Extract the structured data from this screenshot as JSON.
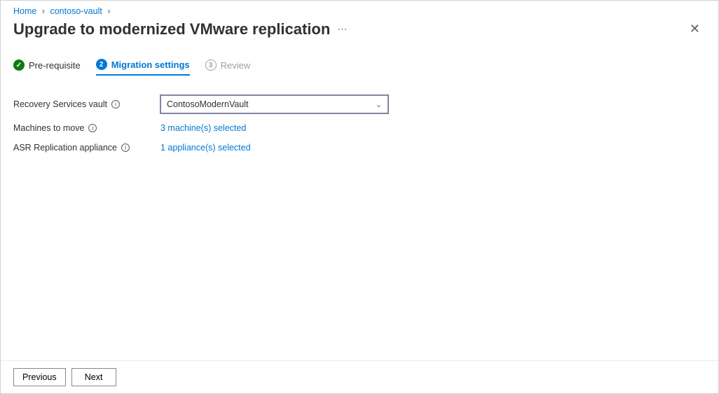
{
  "breadcrumb": {
    "home": "Home",
    "vault": "contoso-vault"
  },
  "title": "Upgrade to modernized VMware replication",
  "steps": {
    "s1": {
      "num": "✓",
      "label": "Pre-requisite"
    },
    "s2": {
      "num": "2",
      "label": "Migration settings"
    },
    "s3": {
      "num": "3",
      "label": "Review"
    }
  },
  "form": {
    "vault_label": "Recovery Services vault",
    "vault_value": "ContosoModernVault",
    "machines_label": "Machines to move",
    "machines_link": "3 machine(s) selected",
    "appliance_label": "ASR Replication appliance",
    "appliance_link": "1 appliance(s) selected"
  },
  "buttons": {
    "previous": "Previous",
    "next": "Next"
  }
}
